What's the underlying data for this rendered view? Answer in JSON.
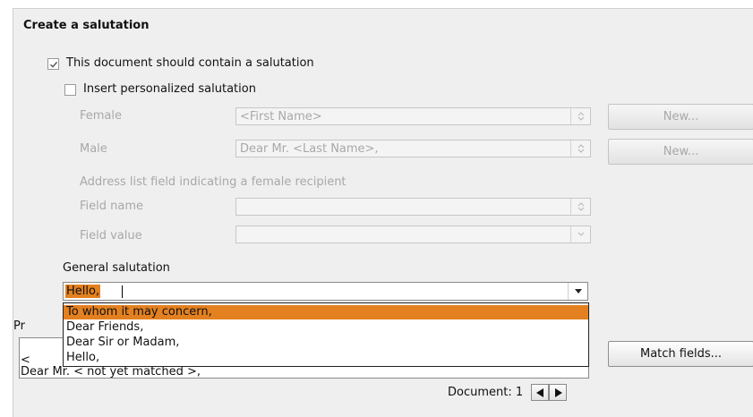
{
  "section_title": "Create a salutation",
  "contain_salutation": {
    "label": "This document should contain a salutation",
    "checked": true
  },
  "personalized": {
    "label": "Insert personalized salutation",
    "checked": false
  },
  "female": {
    "label": "Female",
    "value": "<First Name>",
    "new_label": "New..."
  },
  "male": {
    "label": "Male",
    "value": "Dear Mr. <Last Name>,",
    "new_label": "New..."
  },
  "address_field_caption": "Address list field indicating a female recipient",
  "field_name": {
    "label": "Field name",
    "value": ""
  },
  "field_value": {
    "label": "Field value",
    "value": ""
  },
  "general": {
    "label": "General salutation",
    "value": "Hello,",
    "options": [
      "To whom it may concern,",
      "Dear Friends,",
      "Dear Sir or Madam,",
      "Hello,"
    ],
    "highlighted_index": 0
  },
  "preview": {
    "label_fragment": "Pr",
    "line1": "<",
    "line2": "Dear Mr. < not yet matched >,"
  },
  "match_fields_label": "Match fields...",
  "document_nav": {
    "label": "Document: 1",
    "prev_icon": "left-triangle-icon",
    "next_icon": "right-triangle-icon"
  },
  "colors": {
    "highlight": "#e3801f",
    "panel": "#efefef"
  }
}
